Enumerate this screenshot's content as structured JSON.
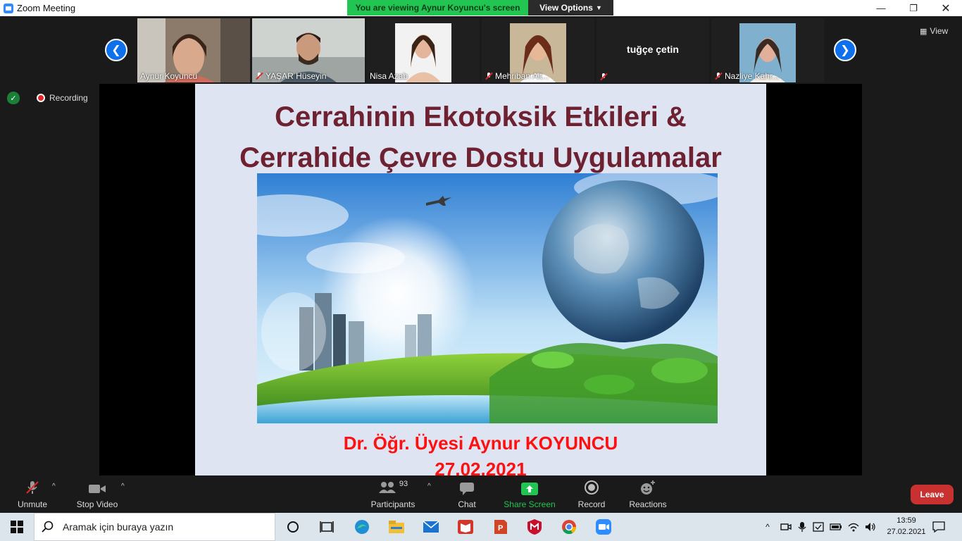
{
  "window": {
    "title": "Zoom Meeting"
  },
  "banner": {
    "viewing_text": "You are viewing Aynur Koyuncu's screen",
    "view_options_label": "View Options"
  },
  "gallery": {
    "view_label": "View",
    "participants": [
      {
        "name": "Aynur Koyuncu",
        "muted": false
      },
      {
        "name": "YAŞAR Hüseyin",
        "muted": true
      },
      {
        "name": "Nisa Azab",
        "muted": false
      },
      {
        "name": "Mehriban Alt...",
        "muted": true
      },
      {
        "name": "tuğçe çetin",
        "muted": true
      },
      {
        "name": "Nazliye Kahr...",
        "muted": true
      }
    ]
  },
  "status": {
    "recording_label": "Recording"
  },
  "slide": {
    "title_line1": "Cerrahinin Ekotoksik Etkileri &",
    "title_line2": "Cerrahide Çevre Dostu Uygulamalar",
    "author": "Dr. Öğr. Üyesi Aynur KOYUNCU",
    "date": "27.02.2021"
  },
  "toolbar": {
    "unmute_label": "Unmute",
    "stop_video_label": "Stop Video",
    "participants_label": "Participants",
    "participants_count": "93",
    "chat_label": "Chat",
    "share_screen_label": "Share Screen",
    "record_label": "Record",
    "reactions_label": "Reactions",
    "leave_label": "Leave"
  },
  "taskbar": {
    "search_placeholder": "Aramak için buraya yazın",
    "time": "13:59",
    "date": "27.02.2021"
  },
  "colors": {
    "zoom_blue": "#0e71eb",
    "banner_green": "#23c552",
    "leave_red": "#c93131",
    "slide_title": "#6e2231",
    "slide_red": "#ff1010"
  }
}
